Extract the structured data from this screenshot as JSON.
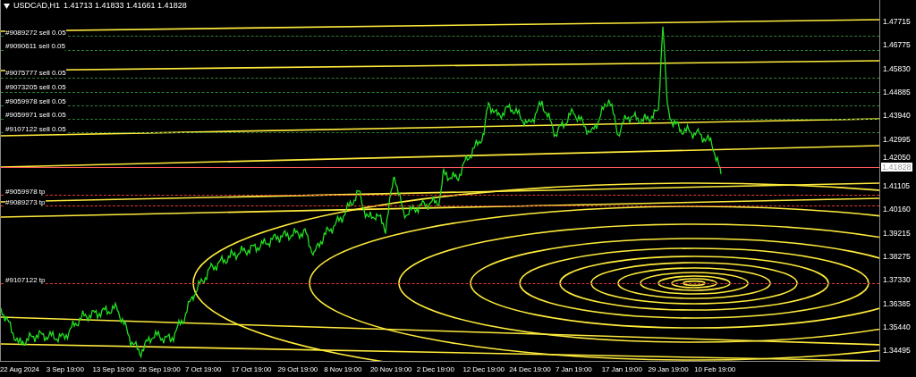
{
  "title": {
    "symbol": "USDCAD,H1",
    "quote": "1.41713 1.41833 1.41661 1.41828"
  },
  "order_lines": [
    {
      "label": "#9089272 sell 0.05",
      "kind": "sell"
    },
    {
      "label": "#9090611 sell 0.05",
      "kind": "sell"
    },
    {
      "label": "#9075777 sell 0.05",
      "kind": "sell"
    },
    {
      "label": "#9073205 sell 0.05",
      "kind": "sell"
    },
    {
      "label": "#9059978 sell 0.05",
      "kind": "sell"
    },
    {
      "label": "#9059971 sell 0.05",
      "kind": "sell"
    },
    {
      "label": "#9107122 sell 0.05",
      "kind": "sell"
    },
    {
      "label": "#9059978 tp",
      "kind": "tp"
    },
    {
      "label": "#9089273 tp",
      "kind": "tp"
    },
    {
      "label": "#9107122 tp",
      "kind": "tp"
    }
  ],
  "current_price": "1.41828",
  "price_axis": [
    "1.47715",
    "1.46775",
    "1.45830",
    "1.44885",
    "1.43940",
    "1.42995",
    "1.42050",
    "1.41105",
    "1.40160",
    "1.39215",
    "1.38275",
    "1.37330",
    "1.36385",
    "1.35440",
    "1.34495"
  ],
  "time_axis": [
    "22 Aug 2024",
    "3 Sep 19:00",
    "13 Sep 19:00",
    "25 Sep 19:00",
    "7 Oct 19:00",
    "17 Oct 19:00",
    "29 Oct 19:00",
    "8 Nov 19:00",
    "20 Nov 19:00",
    "2 Dec 19:00",
    "12 Dec 19:00",
    "24 Dec 19:00",
    "7 Jan 19:00",
    "17 Jan 19:00",
    "29 Jan 19:00",
    "10 Feb 19:00"
  ]
}
